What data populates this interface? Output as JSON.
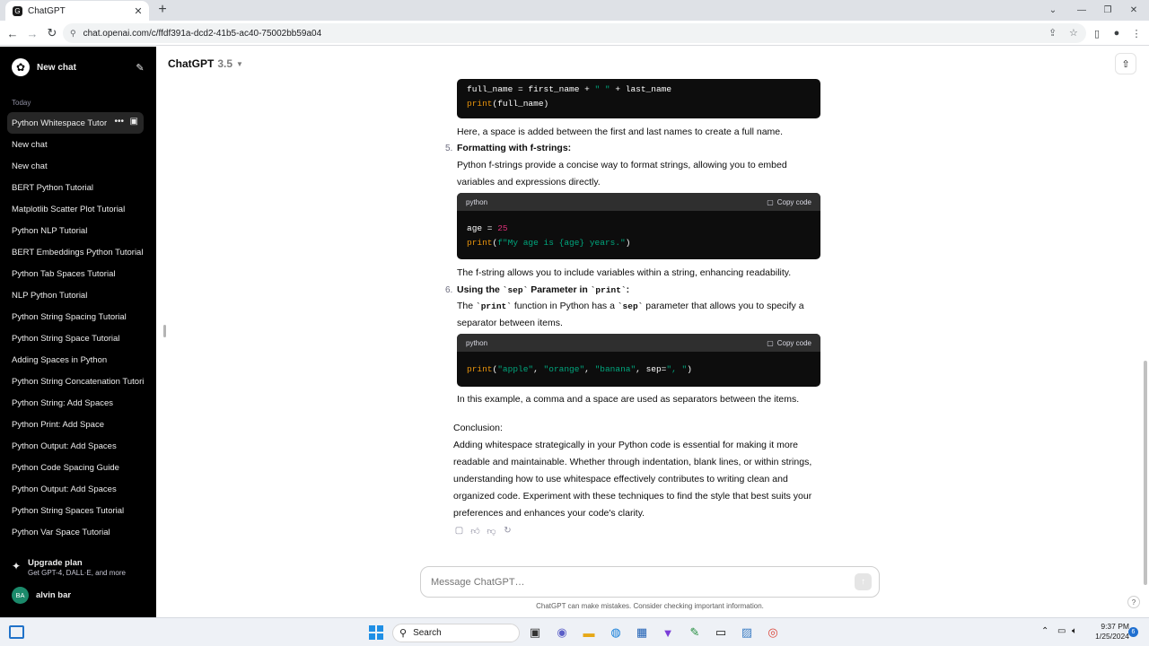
{
  "browser": {
    "tab_title": "ChatGPT",
    "tab_favicon": "G",
    "url": "chat.openai.com/c/ffdf391a-dcd2-41b5-ac40-75002bb59a04"
  },
  "sidebar": {
    "new_chat": "New chat",
    "group_label": "Today",
    "items": [
      "Python Whitespace Tutorial",
      "New chat",
      "New chat",
      "BERT Python Tutorial",
      "Matplotlib Scatter Plot Tutorial",
      "Python NLP Tutorial",
      "BERT Embeddings Python Tutorial",
      "Python Tab Spaces Tutorial",
      "NLP Python Tutorial",
      "Python String Spacing Tutorial",
      "Python String Space Tutorial",
      "Adding Spaces in Python",
      "Python String Concatenation Tutorial",
      "Python String: Add Spaces",
      "Python Print: Add Space",
      "Python Output: Add Spaces",
      "Python Code Spacing Guide",
      "Python Output: Add Spaces",
      "Python String Spaces Tutorial",
      "Python Var Space Tutorial"
    ],
    "upgrade_title": "Upgrade plan",
    "upgrade_sub": "Get GPT-4, DALL·E, and more",
    "user_initials": "BA",
    "user_name": "alvin bar"
  },
  "header": {
    "model_name": "ChatGPT",
    "model_version": "3.5"
  },
  "message": {
    "code1_line1_a": "full_name = first_name + ",
    "code1_line1_str": "\" \"",
    "code1_line1_b": " + last_name",
    "code1_line2": "print(full_name)",
    "p1": "Here, a space is added between the first and last names to create a full name.",
    "item5_num": "5.",
    "item5_title": "Formatting with f-strings:",
    "item5_desc": "Python f-strings provide a concise way to format strings, allowing you to embed variables and expressions directly.",
    "code_lang": "python",
    "copy_label": "Copy code",
    "code2_line1_a": "age = ",
    "code2_line1_num": "25",
    "code2_line2_a": "print(",
    "code2_line2_str": "f\"My age is {age} years.\"",
    "code2_line2_b": ")",
    "p2": "The f-string allows you to include variables within a string, enhancing readability.",
    "item6_num": "6.",
    "item6_title_a": "Using the ",
    "item6_title_code": "`sep`",
    "item6_title_b": " Parameter in ",
    "item6_title_code2": "`print`",
    "item6_title_c": ":",
    "item6_desc_a": "The ",
    "item6_desc_code": "`print`",
    "item6_desc_b": " function in Python has a ",
    "item6_desc_code2": "`sep`",
    "item6_desc_c": " parameter that allows you to specify a separator between items.",
    "code3_a": "print(",
    "code3_s1": "\"apple\"",
    "code3_c1": ", ",
    "code3_s2": "\"orange\"",
    "code3_c2": ", ",
    "code3_s3": "\"banana\"",
    "code3_c3": ", sep=",
    "code3_s4": "\", \"",
    "code3_c4": ")",
    "p3": "In this example, a comma and a space are used as separators between the items.",
    "conclusion_label": "Conclusion:",
    "conclusion_text": "Adding whitespace strategically in your Python code is essential for making it more readable and maintainable. Whether through indentation, blank lines, or within strings, understanding how to use whitespace effectively contributes to writing clean and organized code. Experiment with these techniques to find the style that best suits your preferences and enhances your code's clarity."
  },
  "composer": {
    "placeholder": "Message ChatGPT…",
    "disclaimer": "ChatGPT can make mistakes. Consider checking important information."
  },
  "taskbar": {
    "search_label": "Search",
    "time": "9:37 PM",
    "date": "1/25/2024",
    "notification_count": "6"
  }
}
